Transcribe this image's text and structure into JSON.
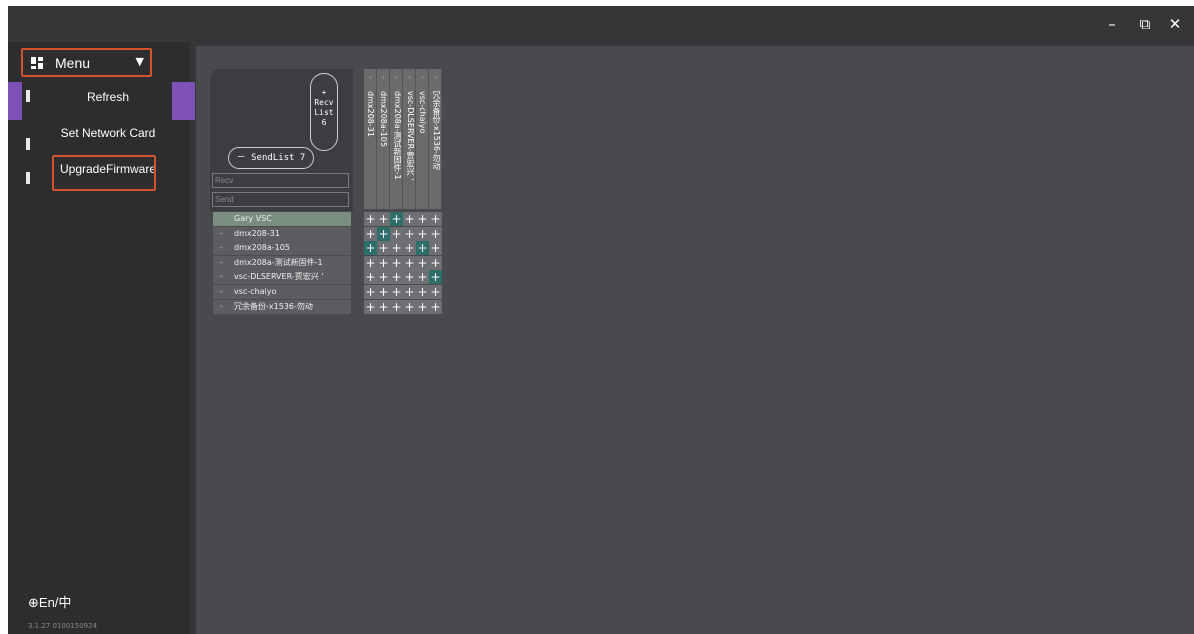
{
  "window_controls": {
    "minimize": "–",
    "restore": "⧉",
    "close": "✕"
  },
  "menu": {
    "label": "Menu",
    "items": [
      "Refresh",
      "Set Network Card",
      "UpgradeFirmware"
    ]
  },
  "language": "En/中",
  "version": "3.1.27  0100150924",
  "matrix": {
    "recv_list": {
      "plus": "+",
      "line1": "Recv",
      "line2": "List",
      "count": "6"
    },
    "send_list": "－ SendList 7",
    "recv_filter_placeholder": "Recv",
    "send_filter_placeholder": "Send",
    "columns": [
      "dmx208-31",
      "dmx208a-105",
      "dmx208a-测试新固件-1",
      "vsc-DLSERVER-贾宏兴 '",
      "vsc-chaiyo",
      "冗余备份-x1536-勿动"
    ],
    "rows": [
      {
        "label": "Gary VSC",
        "selected": true,
        "cells": [
          0,
          0,
          1,
          0,
          0,
          0
        ]
      },
      {
        "label": "dmx208-31",
        "selected": false,
        "cells": [
          0,
          1,
          0,
          0,
          0,
          0
        ]
      },
      {
        "label": "dmx208a-105",
        "selected": false,
        "cells": [
          1,
          0,
          0,
          0,
          1,
          0
        ]
      },
      {
        "label": "dmx208a-测试新固件-1",
        "selected": false,
        "cells": [
          0,
          0,
          0,
          0,
          0,
          0
        ]
      },
      {
        "label": "vsc-DLSERVER-贾宏兴 '",
        "selected": false,
        "cells": [
          0,
          0,
          0,
          0,
          0,
          1
        ]
      },
      {
        "label": "vsc-chaiyo",
        "selected": false,
        "cells": [
          0,
          0,
          0,
          0,
          0,
          0
        ]
      },
      {
        "label": "冗余备份-x1536-勿动",
        "selected": false,
        "cells": [
          0,
          0,
          0,
          0,
          0,
          0
        ]
      }
    ]
  }
}
